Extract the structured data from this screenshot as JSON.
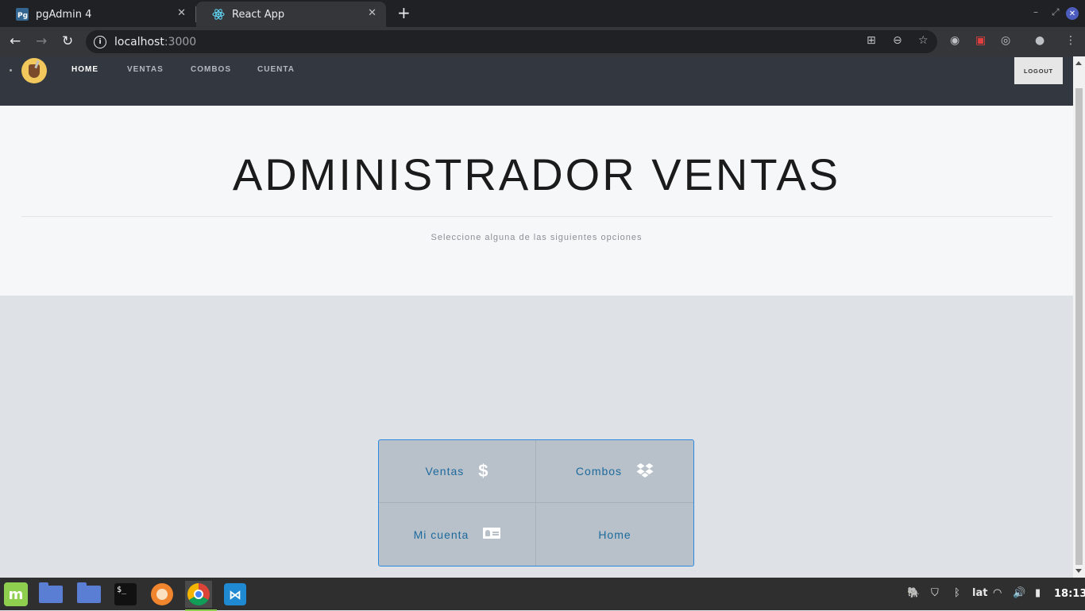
{
  "browser": {
    "tabs": [
      {
        "label": "pgAdmin 4",
        "favicon": "pgadmin-icon"
      },
      {
        "label": "React App",
        "favicon": "react-icon"
      }
    ],
    "new_tab_glyph": "+",
    "address": {
      "host": "localhost",
      "port": ":3000"
    }
  },
  "app": {
    "nav": {
      "home": "HOME",
      "ventas": "VENTAS",
      "combos": "COMBOS",
      "cuenta": "CUENTA",
      "logout": "LOGOUT"
    },
    "hero": {
      "title": "ADMINISTRADOR VENTAS",
      "subtitle": "Seleccione alguna de las siguientes opciones"
    },
    "menu": [
      {
        "label": "Ventas",
        "icon": "dollar-icon"
      },
      {
        "label": "Combos",
        "icon": "dropbox-icon"
      },
      {
        "label": "Mi cuenta",
        "icon": "id-card-icon"
      },
      {
        "label": "Home",
        "icon": ""
      }
    ],
    "colors": {
      "nav_bg": "#33373f",
      "hero_bg": "#f6f7f9",
      "accent_link": "#1d6a9c",
      "grid_border": "#2b8ae0"
    }
  },
  "taskbar": {
    "keyboard_layout": "lat",
    "clock": "18:13"
  }
}
